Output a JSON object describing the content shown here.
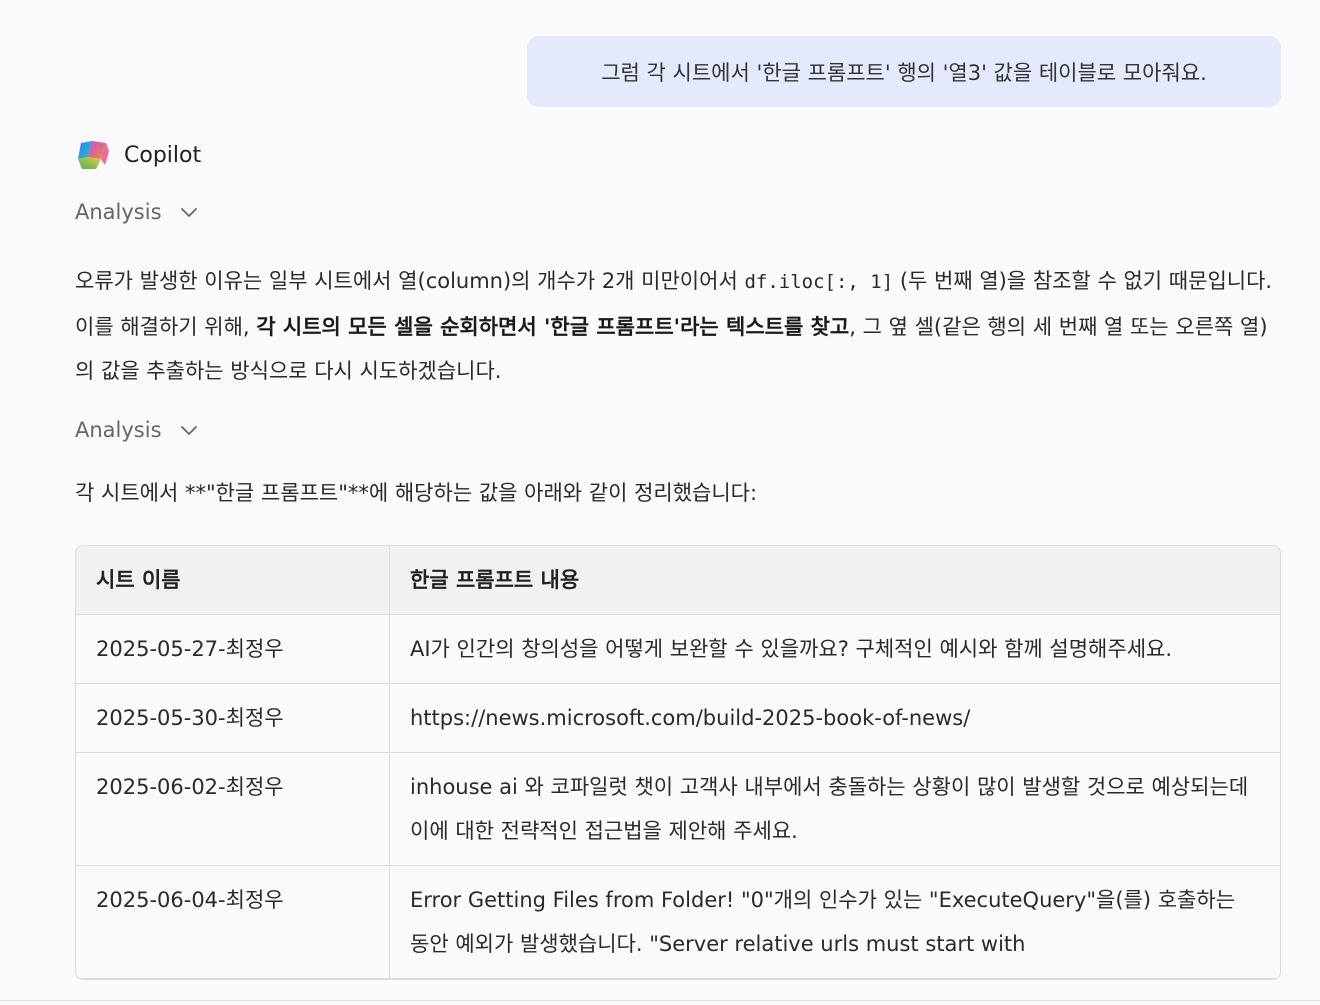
{
  "user_message": "그럼 각 시트에서 '한글 프롬프트' 행의 '열3' 값을 테이블로 모아줘요.",
  "assistant": {
    "name": "Copilot",
    "analysis_label_1": "Analysis",
    "analysis_label_2": "Analysis",
    "para1": {
      "t1": "오류가 발생한 이유는 일부 시트에서 열(column)의 개수가 2개 미만이어서 ",
      "code": "df.iloc[:, 1]",
      "t2": " (두 번째 열)을 참조할 수 없기 때문입니다. 이를 해결하기 위해, ",
      "bold": "각 시트의 모든 셀을 순회하면서 '한글 프롬프트'라는 텍스트를 찾고",
      "t3": ", 그 옆 셀(같은 행의 세 번째 열 또는 오른쪽 열)의 값을 추출하는 방식으로 다시 시도하겠습니다."
    },
    "para2": "각 시트에서 **\"한글 프롬프트\"**에 해당하는 값을 아래와 같이 정리했습니다:"
  },
  "table": {
    "headers": [
      "시트 이름",
      "한글 프롬프트 내용"
    ],
    "rows": [
      [
        "2025-05-27-최정우",
        "AI가 인간의 창의성을 어떻게 보완할 수 있을까요? 구체적인 예시와 함께 설명해주세요."
      ],
      [
        "2025-05-30-최정우",
        "https://news.microsoft.com/build-2025-book-of-news/"
      ],
      [
        "2025-06-02-최정우",
        "inhouse ai 와 코파일럿 챗이 고객사 내부에서 충돌하는 상황이 많이 발생할 것으로 예상되는데 이에 대한 전략적인 접근법을 제안해 주세요."
      ],
      [
        "2025-06-04-최정우",
        "Error Getting Files from Folder! \"0\"개의 인수가 있는 \"ExecuteQuery\"을(를) 호출하는 동안 예외가 발생했습니다. \"Server relative urls must start with"
      ]
    ]
  }
}
